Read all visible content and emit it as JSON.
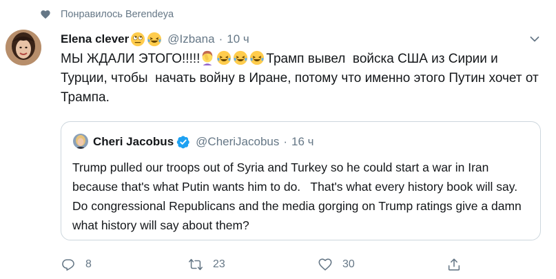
{
  "context": {
    "liked_by_text": "Понравилось Berendeya",
    "icon": "heart-icon"
  },
  "tweet": {
    "author_name": "Elena clever",
    "author_name_emojis": [
      "rolling-eyes-emoji",
      "laughing-tears-emoji"
    ],
    "handle": "@Izbana",
    "separator": "·",
    "time": "10 ч",
    "menu_icon": "chevron-down-icon",
    "text_segments": [
      {
        "type": "text",
        "value": "МЫ ЖДАЛИ ЭТОГО!!!!!"
      },
      {
        "type": "emoji",
        "name": "facepalm-emoji"
      },
      {
        "type": "emoji",
        "name": "laughing-tears-emoji"
      },
      {
        "type": "emoji",
        "name": "laughing-tears-emoji"
      },
      {
        "type": "emoji",
        "name": "laughing-tears-emoji"
      },
      {
        "type": "text",
        "value": "Трамп вывел  войска США из Сирии и Турции, чтобы  начать войну в Иране, потому что именно этого Путин хочет от Трампа."
      }
    ]
  },
  "quoted_tweet": {
    "author_name": "Cheri Jacobus",
    "verified_icon": "verified-badge-icon",
    "handle": "@CheriJacobus",
    "separator": "·",
    "time": "16 ч",
    "text": "Trump pulled our troops out of Syria and Turkey so he could start a war in Iran because that's what Putin wants him to do.   That's what every history book will say.  Do congressional Republicans and the media gorging on Trump ratings give a damn what history will say about them?"
  },
  "actions": {
    "reply": {
      "icon": "reply-icon",
      "count": "8"
    },
    "retweet": {
      "icon": "retweet-icon",
      "count": "23"
    },
    "like": {
      "icon": "heart-icon",
      "count": "30"
    },
    "share": {
      "icon": "share-icon"
    }
  },
  "colors": {
    "secondary_text": "#657786",
    "primary_text": "#14171a",
    "border": "#ccd6dd",
    "verified_blue": "#1da1f2"
  }
}
